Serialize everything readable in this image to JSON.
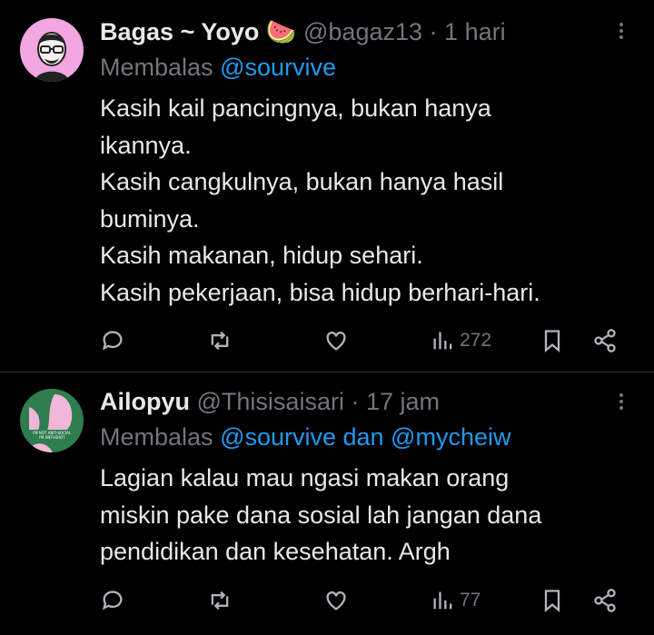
{
  "tweets": [
    {
      "name": "Bagas ~ Yoyo",
      "name_emoji": "🍉",
      "handle": "@bagaz13",
      "separator": "·",
      "time": "1 hari",
      "reply_prefix": "Membalas",
      "reply_mentions": "@sourvive",
      "body_lines": [
        "Kasih kail pancingnya, bukan hanya",
        "ikannya.",
        "Kasih cangkulnya, bukan hanya hasil",
        "buminya.",
        "Kasih makanan, hidup sehari.",
        "Kasih pekerjaan, bisa hidup berhari-hari."
      ],
      "views": "272",
      "avatar_bg": "#f2a7e0"
    },
    {
      "name": "Ailopyu",
      "handle": "@Thisisaisari",
      "separator": "·",
      "time": "17 jam",
      "reply_prefix": "Membalas",
      "reply_mentions": "@sourvive dan @mycheiw",
      "body_lines": [
        "Lagian kalau mau ngasi makan orang",
        "miskin pake dana sosial lah jangan dana",
        "pendidikan dan kesehatan. Argh"
      ],
      "views": "77",
      "avatar_bg": "#2e7d4f",
      "avatar_text": "I'M NOT ANTI-SOCIAL I'M ANTI-IDIOT"
    }
  ],
  "colors": {
    "background": "#000000",
    "text": "#e7e9ea",
    "muted": "#71767b",
    "accent": "#1d9bf0",
    "divider": "#2f3336"
  },
  "icons": [
    "reply-icon",
    "retweet-icon",
    "like-icon",
    "views-icon",
    "bookmark-icon",
    "share-icon",
    "more-icon"
  ]
}
